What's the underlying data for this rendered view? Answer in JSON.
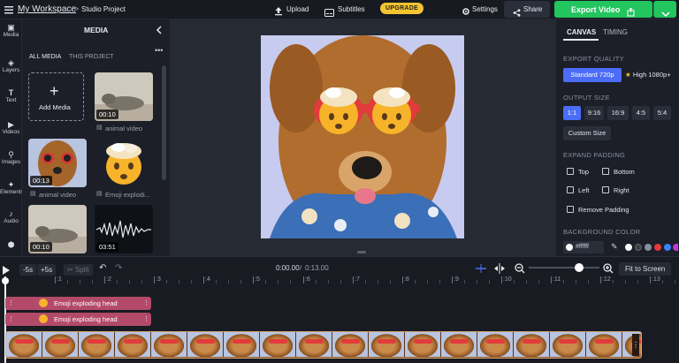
{
  "topbar": {
    "workspace": "My Workspace",
    "breadcrumb_sep": ">",
    "project": "Studio Project",
    "upload": "Upload",
    "subtitles": "Subtitles",
    "upgrade": "UPGRADE",
    "settings": "Settings",
    "share": "Share",
    "export": "Export Video"
  },
  "rail": {
    "items": [
      "Media",
      "Layers",
      "Text",
      "Videos",
      "Images",
      "Elements",
      "Audio"
    ]
  },
  "media": {
    "title": "MEDIA",
    "tabs": [
      "ALL MEDIA",
      "THIS PROJECT"
    ],
    "add_label": "Add Media",
    "tiles": [
      {
        "duration": "00:10",
        "caption": "animal video"
      },
      {
        "duration": "00:13",
        "caption": "animal video"
      },
      {
        "caption": "Emoji explodi..."
      },
      {
        "duration": "00:10"
      },
      {
        "duration": "03:51"
      }
    ]
  },
  "props": {
    "tabs": [
      "CANVAS",
      "TIMING"
    ],
    "export_quality_label": "EXPORT QUALITY",
    "quality_options": [
      "Standard 720p",
      "High 1080p+"
    ],
    "output_size_label": "OUTPUT SIZE",
    "sizes": [
      "1:1",
      "9:16",
      "16:9",
      "4:5",
      "5:4"
    ],
    "custom_size": "Custom Size",
    "expand_padding_label": "EXPAND PADDING",
    "padding": [
      "Top",
      "Bottom",
      "Left",
      "Right"
    ],
    "remove_padding": "Remove Padding",
    "background_color_label": "BACKGROUND COLOR",
    "background_value": "#ffffff",
    "swatches": [
      "#ffffff",
      "#3b3f4a",
      "#8a8f9c",
      "#e23b3b",
      "#3b82f6",
      "#c03ad6"
    ]
  },
  "timeline": {
    "skip_back": "-5s",
    "skip_forward": "+5s",
    "split": "Split",
    "time_current": "0:00.00",
    "time_sep": "/",
    "time_total": "0:13.00",
    "fit": "Fit to Screen",
    "ruler": [
      ":1",
      ":2",
      ":3",
      ":4",
      ":5",
      ":6",
      ":7",
      ":8",
      ":9",
      ":10",
      ":11",
      ":12",
      ":13"
    ],
    "clips": [
      "Emoji exploding head",
      "Emoji exploding head"
    ]
  },
  "colors": {
    "accent": "#22c55e",
    "upgrade": "#f5c431",
    "selected": "#4a6cf7",
    "emoji_clip": "#b34a69"
  }
}
